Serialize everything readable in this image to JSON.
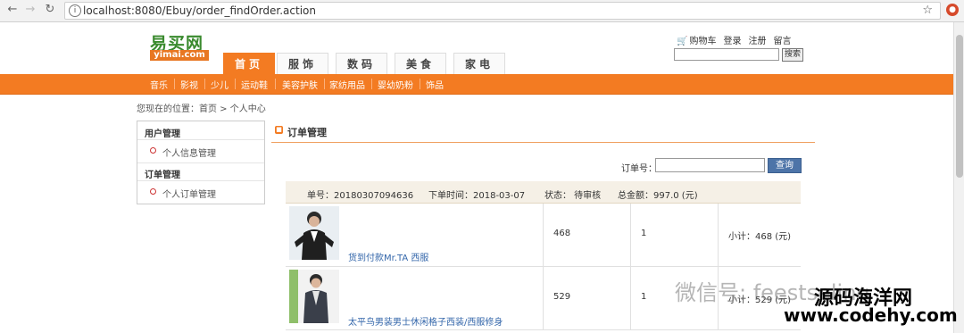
{
  "browser": {
    "url": "localhost:8080/Ebuy/order_findOrder.action"
  },
  "logo": {
    "cn": "易买网",
    "en": "yimai.com"
  },
  "top_links": {
    "cart": "购物车",
    "login": "登录",
    "register": "注册",
    "message": "留言"
  },
  "search_btn": "搜索",
  "tabs": [
    "首页",
    "服饰",
    "数码",
    "美食",
    "家电"
  ],
  "categories": [
    "音乐",
    "影视",
    "少儿",
    "运动鞋",
    "美容护肤",
    "家纺用品",
    "婴幼奶粉",
    "饰品"
  ],
  "breadcrumb": "您现在的位置：首页 > 个人中心",
  "left_menu": {
    "user_head": "用户管理",
    "user_item": "个人信息管理",
    "order_head": "订单管理",
    "order_item": "个人订单管理"
  },
  "panel": {
    "title": "订单管理",
    "filter_label": "订单号：",
    "filter_btn": "查询"
  },
  "order": {
    "number": "单号：20180307094636",
    "time": "下单时间：2018-03-07",
    "status": "状态： 待审核",
    "total": "总金额：997.0 (元)"
  },
  "items": [
    {
      "name": "货到付款Mr.TA 西服",
      "price": "468",
      "qty": "1",
      "subtotal": "小计：468 (元)"
    },
    {
      "name": "太平鸟男装男士休闲格子西装/西服修身",
      "price": "529",
      "qty": "1",
      "subtotal": "小计：529 (元)"
    }
  ],
  "watermark": {
    "wechat": "微信号: feestseling",
    "site_cn": "源码海洋网",
    "site_url": "www.codehy.com"
  }
}
